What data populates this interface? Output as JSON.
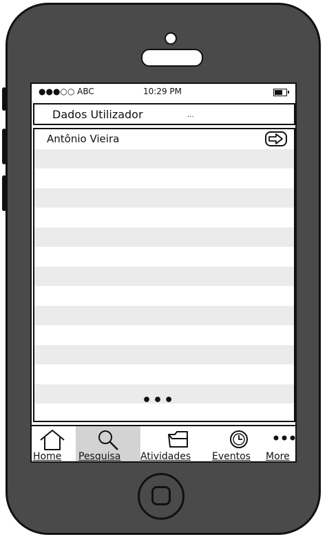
{
  "status_bar": {
    "carrier": "●●●○○ ABC",
    "time": "10:29 PM"
  },
  "header": {
    "title": "Dados Utilizador",
    "ellipsis": "..."
  },
  "list": {
    "items": [
      {
        "label": "Antônio Vieira"
      }
    ],
    "more_indicator": "•••"
  },
  "tabbar": {
    "tabs": [
      {
        "label": "Home",
        "icon": "home-icon"
      },
      {
        "label": "Pesquisa",
        "icon": "search-icon",
        "selected": true
      },
      {
        "label": "Atividades",
        "icon": "folder-icon"
      },
      {
        "label": "Eventos",
        "icon": "clock-icon"
      },
      {
        "label": "More",
        "icon": "more-icon"
      }
    ]
  }
}
